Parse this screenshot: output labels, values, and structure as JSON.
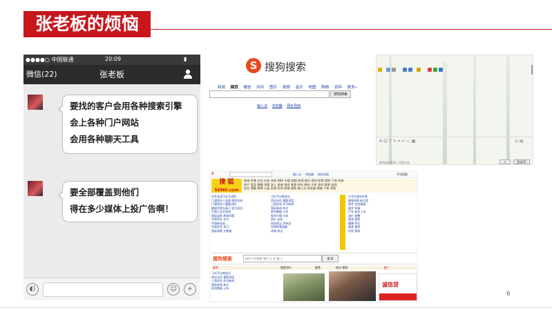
{
  "slide": {
    "title": "张老板的烦恼",
    "page_number": "6"
  },
  "phone": {
    "status": {
      "carrier": "●●●●○ 中国联通",
      "time": "20:09",
      "battery": "▮"
    },
    "nav": {
      "back": "微信(22)",
      "title": "张老板"
    },
    "messages": [
      {
        "lines": [
          "要找的客户会用各种搜索引擎",
          "会上各种门户网站",
          "会用各种聊天工具"
        ]
      },
      {
        "lines": [
          "要全部覆盖到他们",
          "得在多少媒体上投广告啊！"
        ]
      }
    ],
    "input_bar": {
      "voice_icon": "voice-icon",
      "emoji_icon": "emoji-icon",
      "plus_icon": "plus-icon"
    }
  },
  "sogou": {
    "logo_letter": "S",
    "logo_text": "搜狗搜索",
    "tabs": [
      "新闻",
      "网页",
      "微信",
      "问问",
      "图片",
      "视频",
      "音乐",
      "地图",
      "购物",
      "百科",
      "更多»"
    ],
    "search_button": "搜狗搜索",
    "links": [
      "输入法",
      "浏览器",
      "网址导航"
    ]
  },
  "chatwin": {
    "footer_left": "使用高级表情 | 消息记录",
    "footer_right": "发送(S)"
  },
  "sohu": {
    "logo_line1": "搜 狐",
    "logo_line2": "SOHU.com",
    "top_links": [
      "输入法",
      "浏览器",
      "网址导航",
      "手机搜狐"
    ],
    "nav_rows": [
      "新闻 军事 文化 历史 体育 NBA 中超 视频 影视 娱乐 财经 股票 理财 汽车 购车",
      "房产 家居 健康 母婴 女人 星座 旅游 美食 科技 数码 手机 游戏 教育 出国",
      "社区 博客 微博 公益 彩票 时尚 商城 搜狗 输入法 浏览器 邮箱 千帆 导航"
    ],
    "left_col": [
      "台军会战习近平讲话",
      "门通领导人会晤 两岸关系",
      "门通领导人重要讲话",
      "解放军登岛演习 官方回应",
      "中国人自主研发",
      "国际局势 南海问题",
      "中国军队 实力",
      "军改新动向",
      "中国空军 演习",
      "国际观察 大数据"
    ],
    "mid_col": [
      "习近平出席会议",
      "首次访问 重要讲话",
      "三国关系 外交新闻",
      "国际新闻 热点",
      "经济数据 公布",
      "股市行情 分析",
      "房价 走势",
      "科技前沿 发布会",
      "世界杯预选赛",
      "体育 热点"
    ],
    "right_col": [
      "大学生就业形势",
      "教育改革 新方案",
      "高考 志愿填报",
      "留学 申请",
      "汽车 新车上市",
      "油价 调整",
      "旅游 推荐",
      "健康 养生",
      "美食 推荐",
      "时尚 潮流"
    ],
    "search_logo": "搜狗搜索",
    "search_placeholder": "网页 ▾ 中国梦 我们 正 在 路 上",
    "search_button": "搜 索",
    "bottom_tabs": [
      "要闻",
      "搜索排行",
      "推荐",
      "热点·视频",
      "推广"
    ],
    "ad_text": "诚信贷"
  }
}
